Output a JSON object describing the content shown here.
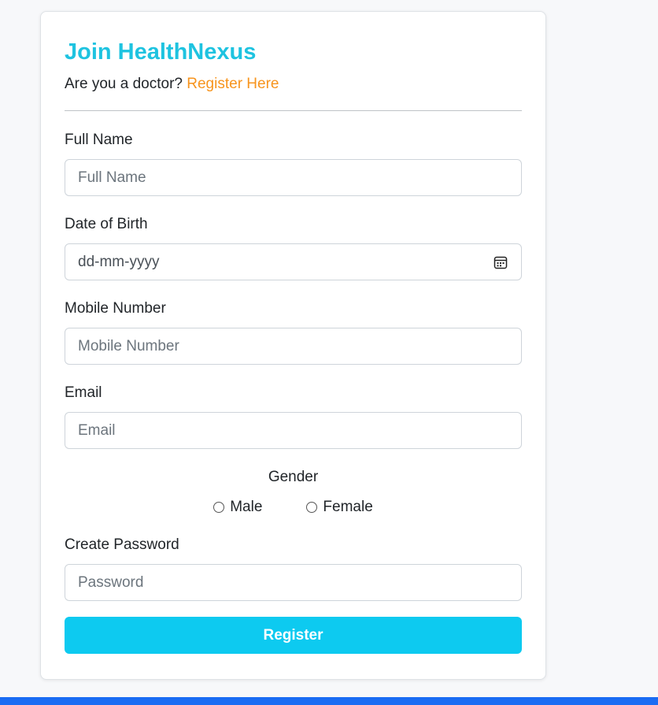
{
  "form": {
    "title": "Join HealthNexus",
    "doctor_prompt": "Are you a doctor?",
    "doctor_link": "Register Here",
    "full_name": {
      "label": "Full Name",
      "placeholder": "Full Name"
    },
    "dob": {
      "label": "Date of Birth",
      "value": "dd-mm-yyyy"
    },
    "mobile": {
      "label": "Mobile Number",
      "placeholder": "Mobile Number"
    },
    "email": {
      "label": "Email",
      "placeholder": "Email"
    },
    "gender": {
      "label": "Gender",
      "options": [
        "Male",
        "Female"
      ]
    },
    "password": {
      "label": "Create Password",
      "placeholder": "Password"
    },
    "submit_label": "Register"
  },
  "icons": {
    "dob_icon": "calendar-icon"
  },
  "colors": {
    "title": "#1ec3e0",
    "link": "#f7941d",
    "button": "#0dcaf0",
    "bottom_bar": "#1a6cf3"
  }
}
